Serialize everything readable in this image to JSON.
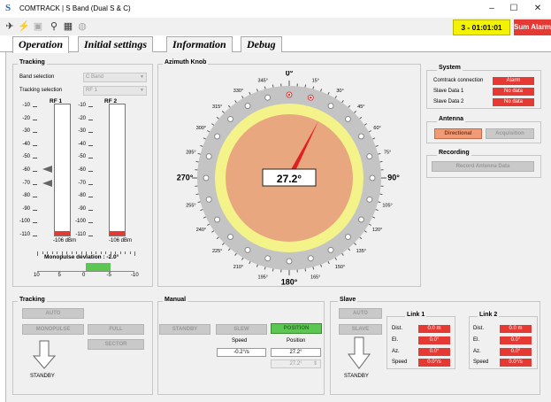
{
  "window": {
    "title": "COMTRACK | S Band (Dual S & C)",
    "minimize": "–",
    "maximize": "☐",
    "close": "✕"
  },
  "toolbar": {
    "clock": "3 - 01:01:01",
    "alarm": "Sum Alarm"
  },
  "tabs": [
    "Operation",
    "Initial settings",
    "Information",
    "Debug"
  ],
  "tracking_panel": {
    "title": "Tracking",
    "band_label": "Band selection",
    "band_value": "C Band",
    "tracking_label": "Tracking selection",
    "tracking_value": "RF 1",
    "rf1": {
      "label": "RF 1",
      "value": "-106 dBm",
      "level_dbm": -106
    },
    "rf2": {
      "label": "RF 2",
      "value": "-106 dBm",
      "level_dbm": -106
    },
    "scale": [
      "-10",
      "-20",
      "-30",
      "-40",
      "-50",
      "-60",
      "-70",
      "-80",
      "-90",
      "-100",
      "-110"
    ],
    "monopulse_label": "Monopulse déviation : -2.0°",
    "monopulse_deviation_deg": -2.0,
    "monopulse_ticks": [
      "10",
      "5",
      "0",
      "-5",
      "-10"
    ]
  },
  "azimuth": {
    "title": "Azimuth Knob",
    "value": "27.2°",
    "needle_deg": 27.2,
    "angle_labels": [
      {
        "t": "0°",
        "a": 0,
        "b": true
      },
      {
        "t": "15°",
        "a": 15
      },
      {
        "t": "30°",
        "a": 30
      },
      {
        "t": "45°",
        "a": 45
      },
      {
        "t": "60°",
        "a": 60
      },
      {
        "t": "75°",
        "a": 75
      },
      {
        "t": "90°",
        "a": 90,
        "b": true
      },
      {
        "t": "105°",
        "a": 105
      },
      {
        "t": "120°",
        "a": 120
      },
      {
        "t": "135°",
        "a": 135
      },
      {
        "t": "150°",
        "a": 150
      },
      {
        "t": "165°",
        "a": 165
      },
      {
        "t": "180°",
        "a": 180,
        "b": true
      },
      {
        "t": "195°",
        "a": 195
      },
      {
        "t": "210°",
        "a": 210
      },
      {
        "t": "225°",
        "a": 225
      },
      {
        "t": "240°",
        "a": 240
      },
      {
        "t": "255°",
        "a": 255
      },
      {
        "t": "270°",
        "a": 270,
        "b": true
      },
      {
        "t": "285°",
        "a": 285
      },
      {
        "t": "300°",
        "a": 300
      },
      {
        "t": "315°",
        "a": 315
      },
      {
        "t": "330°",
        "a": 330
      },
      {
        "t": "345°",
        "a": 345
      }
    ],
    "marked_dot_angles": [
      0,
      15
    ]
  },
  "system": {
    "title": "System",
    "rows": [
      {
        "label": "Comtrack connection",
        "value": "Alarm"
      },
      {
        "label": "Slave Data 1",
        "value": "No data"
      },
      {
        "label": "Slave Data 2",
        "value": "No data"
      }
    ]
  },
  "antenna": {
    "title": "Antenna",
    "directional": "Directional",
    "acquisition": "Acquisition"
  },
  "recording": {
    "title": "Recording",
    "button": "Record Antenna Data"
  },
  "tracking_bottom": {
    "title": "Tracking",
    "auto": "AUTO",
    "monopulse": "MONOPULSE",
    "full": "FULL",
    "sector": "SECTOR",
    "status": "STANDBY"
  },
  "manual": {
    "title": "Manual",
    "standby": "STANDBY",
    "slew": "SLEW",
    "position": "POSITION",
    "speed_label": "Speed",
    "speed_value": "-0.2°/s",
    "position_label": "Position",
    "position_value": "27.2°",
    "position_input": "27.2°"
  },
  "slave": {
    "title": "Slave",
    "auto": "AUTO",
    "slave": "SLAVE",
    "status": "STANDBY",
    "links": [
      {
        "title": "Link 1",
        "dist": "0.0 m",
        "el": "0.0°",
        "az": "0.0°",
        "speed": "0.0°/s"
      },
      {
        "title": "Link 2",
        "dist": "0.0 m",
        "el": "0.0°",
        "az": "0.0°",
        "speed": "0.0°/s"
      }
    ],
    "dist_label": "Dist.",
    "el_label": "El.",
    "az_label": "Az.",
    "speed_label": "Speed"
  }
}
